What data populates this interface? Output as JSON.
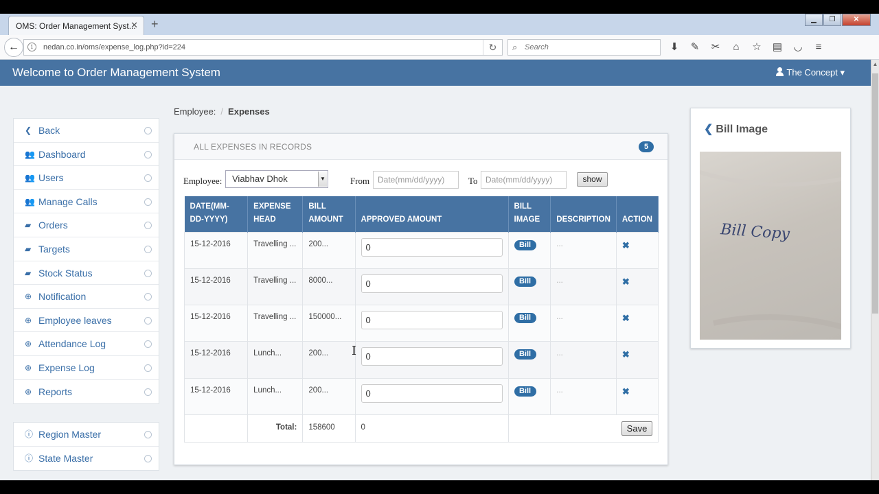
{
  "browser": {
    "tab_title": "OMS: Order Management Syst...",
    "url": "nedan.co.in/oms/expense_log.php?id=224",
    "search_placeholder": "Search"
  },
  "app": {
    "title": "Welcome to Order Management System",
    "user": "The Concept"
  },
  "sidebar": {
    "items": [
      {
        "label": "Back",
        "icon": "chevron-left-icon"
      },
      {
        "label": "Dashboard",
        "icon": "users-icon"
      },
      {
        "label": "Users",
        "icon": "users-icon"
      },
      {
        "label": "Manage Calls",
        "icon": "users-icon"
      },
      {
        "label": "Orders",
        "icon": "book-icon"
      },
      {
        "label": "Targets",
        "icon": "book-icon"
      },
      {
        "label": "Stock Status",
        "icon": "book-icon"
      },
      {
        "label": "Notification",
        "icon": "plus-circle-icon"
      },
      {
        "label": "Employee leaves",
        "icon": "plus-circle-icon"
      },
      {
        "label": "Attendance Log",
        "icon": "plus-circle-icon"
      },
      {
        "label": "Expense Log",
        "icon": "plus-circle-icon"
      },
      {
        "label": "Reports",
        "icon": "plus-circle-icon"
      }
    ],
    "items2": [
      {
        "label": "Region Master",
        "icon": "info-icon"
      },
      {
        "label": "State Master",
        "icon": "info-icon"
      }
    ]
  },
  "breadcrumb": {
    "parent": "Employee:",
    "current": "Expenses"
  },
  "panel": {
    "title": "ALL EXPENSES IN RECORDS",
    "count": "5",
    "filters": {
      "employee_label": "Employee:",
      "employee_value": "Viabhav Dhok",
      "from_label": "From",
      "from_placeholder": "Date(mm/dd/yyyy)",
      "to_label": "To",
      "to_placeholder": "Date(mm/dd/yyyy)",
      "show_label": "show"
    },
    "columns": [
      "DATE(MM-DD-YYYY)",
      "EXPENSE HEAD",
      "BILL AMOUNT",
      "APPROVED AMOUNT",
      "BILL IMAGE",
      "DESCRIPTION",
      "ACTION"
    ],
    "rows": [
      {
        "date": "15-12-2016",
        "head": "Travelling ...",
        "amount": "200...",
        "approved": "0",
        "bill": "Bill",
        "desc": "..."
      },
      {
        "date": "15-12-2016",
        "head": "Travelling ...",
        "amount": "8000...",
        "approved": "0",
        "bill": "Bill",
        "desc": "..."
      },
      {
        "date": "15-12-2016",
        "head": "Travelling ...",
        "amount": "150000...",
        "approved": "0",
        "bill": "Bill",
        "desc": "..."
      },
      {
        "date": "15-12-2016",
        "head": "Lunch...",
        "amount": "200...",
        "approved": "0",
        "bill": "Bill",
        "desc": "..."
      },
      {
        "date": "15-12-2016",
        "head": "Lunch...",
        "amount": "200...",
        "approved": "0",
        "bill": "Bill",
        "desc": "..."
      }
    ],
    "total_label": "Total:",
    "total_amount": "158600",
    "total_approved": "0",
    "save_label": "Save"
  },
  "bill_image": {
    "title": "Bill Image",
    "handwriting": "Bill Copy"
  }
}
